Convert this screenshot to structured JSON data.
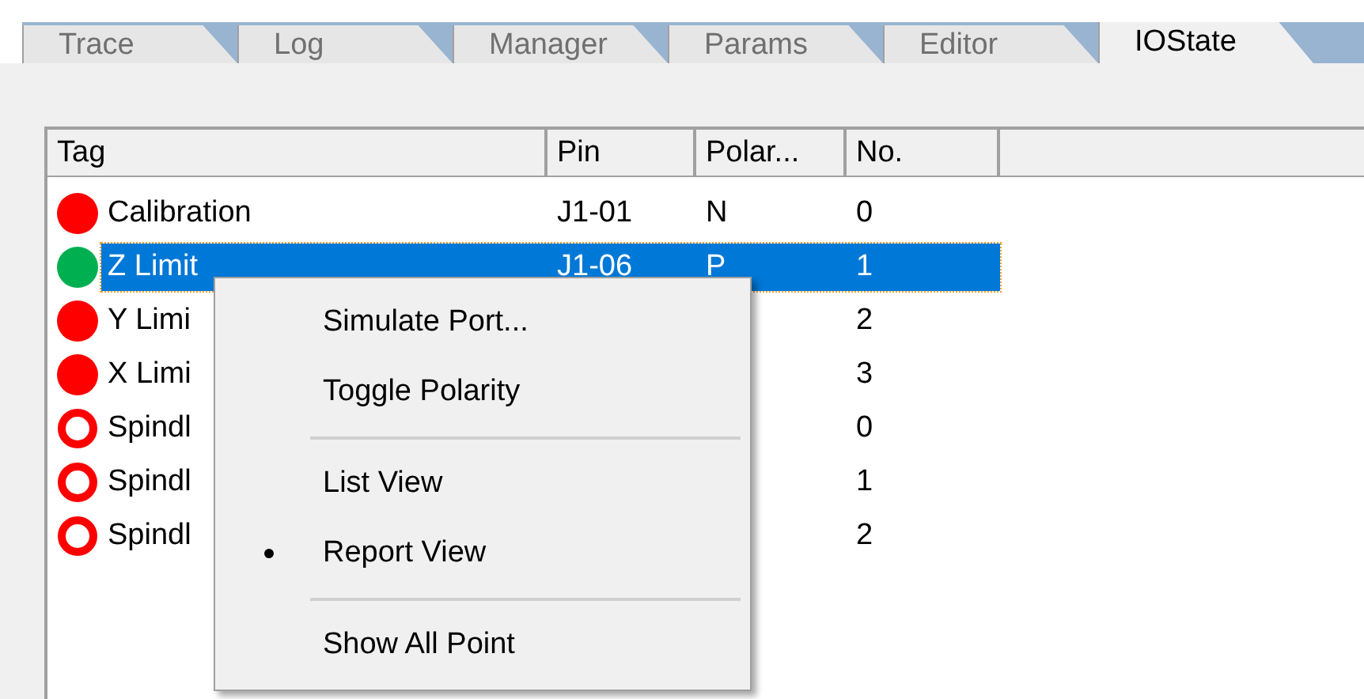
{
  "tabs": [
    {
      "label": "Trace",
      "selected": false
    },
    {
      "label": "Log",
      "selected": false
    },
    {
      "label": "Manager",
      "selected": false
    },
    {
      "label": "Params",
      "selected": false
    },
    {
      "label": "Editor",
      "selected": false
    },
    {
      "label": "IOState",
      "selected": true
    }
  ],
  "table": {
    "columns": [
      "Tag",
      "Pin",
      "Polar...",
      "No."
    ],
    "rows": [
      {
        "tag": "Calibration",
        "pin": "J1-01",
        "polarity": "N",
        "no": "0",
        "lit": true,
        "color": "#ff0000",
        "selected": false
      },
      {
        "tag": "Z Limit",
        "pin": "J1-06",
        "polarity": "P",
        "no": "1",
        "lit": true,
        "color": "#00b050",
        "selected": true
      },
      {
        "tag": "Y Limi",
        "no": "2",
        "lit": true,
        "color": "#ff0000",
        "selected": false
      },
      {
        "tag": "X Limi",
        "no": "3",
        "lit": true,
        "color": "#ff0000",
        "selected": false
      },
      {
        "tag": "Spindl",
        "no": "0",
        "lit": false,
        "color": "#ff0000",
        "selected": false
      },
      {
        "tag": "Spindl",
        "no": "1",
        "lit": false,
        "color": "#ff0000",
        "selected": false
      },
      {
        "tag": "Spindl",
        "no": "2",
        "lit": false,
        "color": "#ff0000",
        "selected": false
      }
    ]
  },
  "context_menu": {
    "items": [
      {
        "kind": "item",
        "label": "Simulate Port...",
        "checked": false
      },
      {
        "kind": "item",
        "label": "Toggle Polarity",
        "checked": false
      },
      {
        "kind": "separator"
      },
      {
        "kind": "item",
        "label": "List View",
        "checked": false
      },
      {
        "kind": "item",
        "label": "Report View",
        "checked": true
      },
      {
        "kind": "separator"
      },
      {
        "kind": "item",
        "label": "Show All Point",
        "checked": false
      }
    ]
  }
}
